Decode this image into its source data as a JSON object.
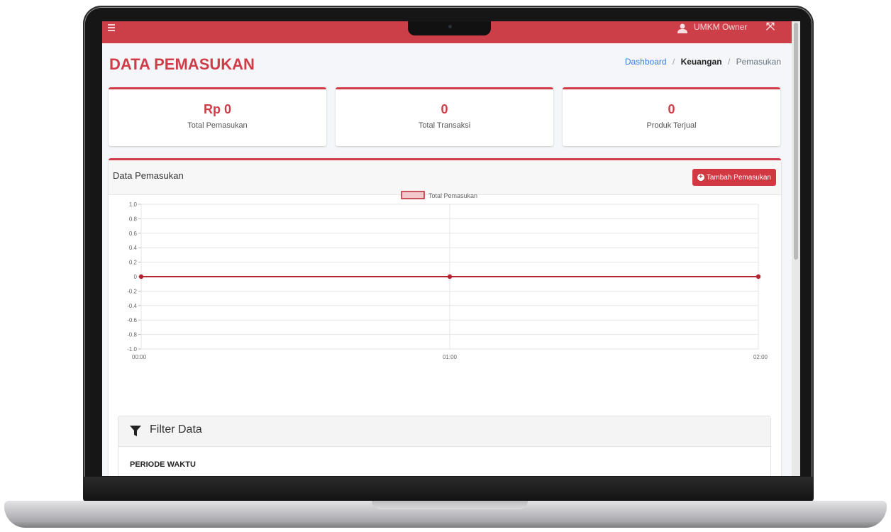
{
  "topbar": {
    "user_name": "UMKM Owner",
    "accent_color": "#cc3e48",
    "menu_icon": "hamburger-icon",
    "user_icon": "user-icon",
    "expand_icon": "expand-icon"
  },
  "header": {
    "title": "DATA PEMASUKAN",
    "breadcrumb": [
      "Dashboard",
      "Keuangan",
      "Pemasukan"
    ]
  },
  "stats": [
    {
      "value": "Rp 0",
      "label": "Total Pemasukan"
    },
    {
      "value": "0",
      "label": "Total Transaksi"
    },
    {
      "value": "0",
      "label": "Produk Terjual"
    }
  ],
  "main_card": {
    "title": "Data Pemasukan",
    "add_button_label": "Tambah Pemasukan",
    "add_button_icon": "plus-circle-icon"
  },
  "filter": {
    "title": "Filter Data",
    "icon": "filter-icon",
    "period_label": "PERIODE WAKTU"
  },
  "chart_data": {
    "type": "line",
    "x": [
      "00:00",
      "01:00",
      "02:00"
    ],
    "series": [
      {
        "name": "Total Pemasukan",
        "values": [
          0,
          0,
          0
        ],
        "color": "#b52531"
      }
    ],
    "ylim": [
      -1.0,
      1.0
    ],
    "yticks": [
      "1.0",
      "0.8",
      "0.6",
      "0.4",
      "0.2",
      "0",
      "-0.2",
      "-0.4",
      "-0.6",
      "-0.8",
      "-1.0"
    ],
    "grid": true,
    "legend": "top-center"
  }
}
